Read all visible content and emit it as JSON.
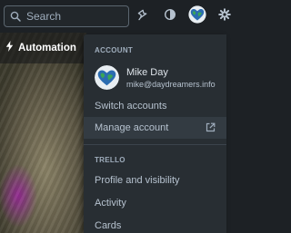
{
  "search": {
    "placeholder": "Search"
  },
  "topbar": {
    "icons": [
      "search-icon",
      "notifications-bell-icon",
      "theme-toggle-icon",
      "avatar-globe-icon",
      "settings-gear-icon"
    ]
  },
  "board": {
    "automation_label": "Automation"
  },
  "account_menu": {
    "section_account": "ACCOUNT",
    "user": {
      "name": "Mike Day",
      "email": "mike@daydreamers.info"
    },
    "switch_accounts": "Switch accounts",
    "manage_account": "Manage account",
    "section_trello": "TRELLO",
    "profile_visibility": "Profile and visibility",
    "activity": "Activity",
    "cards": "Cards"
  },
  "colors": {
    "background": "#1d2125",
    "menu": "#282e33",
    "hover": "#333b42",
    "text": "#b6c2cf"
  }
}
